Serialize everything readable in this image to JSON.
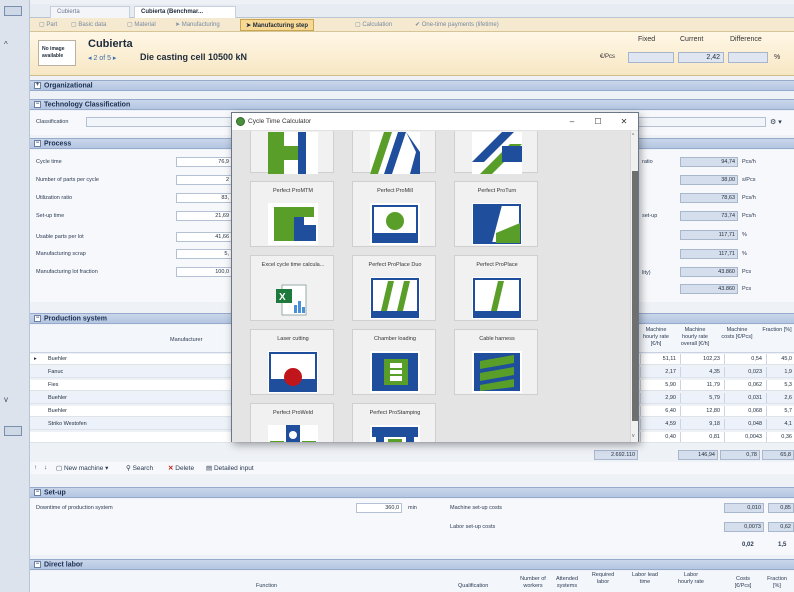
{
  "window_tabs": [
    {
      "label": "Cubierta",
      "active": false
    },
    {
      "label": "Cubierta (Benchmar...",
      "active": true
    }
  ],
  "sub_tabs": [
    {
      "label": "Part",
      "active": false
    },
    {
      "label": "Basic data",
      "active": false
    },
    {
      "label": "Material",
      "active": false
    },
    {
      "label": "Manufacturing",
      "active": false
    },
    {
      "label": "Manufacturing step",
      "active": true
    },
    {
      "label": "Calculation",
      "active": false
    },
    {
      "label": "One-time payments (lifetime)",
      "active": false
    }
  ],
  "header": {
    "no_image": "No image available",
    "title": "Cubierta",
    "nav": "◂ 2 of 5 ▸",
    "subtitle": "Die casting cell 10500 kN",
    "unit": "€/Pcs",
    "col_fixed": "Fixed",
    "col_current": "Current",
    "col_difference": "Difference",
    "current_value": "2,42",
    "percent": "%"
  },
  "sections": {
    "organizational": "Organizational",
    "tech_classification": "Technology Classification",
    "process": "Process",
    "production_system": "Production system",
    "setup": "Set-up",
    "direct_labor": "Direct labor"
  },
  "tech": {
    "classification_label": "Classification"
  },
  "process": {
    "labels": [
      "Cycle time",
      "Number of parts per cycle",
      "Utilization ratio",
      "Set-up time",
      "Usable parts per lot",
      "Manufacturing scrap",
      "Manufacturing lot fraction"
    ],
    "values": [
      "76,9",
      "2",
      "83,",
      "21,69",
      "41,66",
      "5,",
      "100,0"
    ],
    "right_labels": [
      "ratio",
      "",
      "",
      "set-up",
      "",
      "",
      "lity)",
      ""
    ],
    "right_values": [
      "94,74",
      "38,00",
      "78,63",
      "73,74",
      "117,71",
      "117,71",
      "43.860",
      "43.860"
    ],
    "right_units": [
      "Pcs/h",
      "s/Pcs",
      "Pcs/h",
      "Pcs/h",
      "%",
      "%",
      "Pcs",
      "Pcs"
    ]
  },
  "production": {
    "col_manufacturer": "Manufacturer",
    "headers": [
      "Machine hourly rate [€/h]",
      "Machine hourly rate overall [€/h]",
      "Machine costs [€/Pcs]",
      "Fraction [%]"
    ],
    "rows": [
      {
        "name": "Buehler",
        "v": [
          "51,11",
          "102,23",
          "0,54",
          "45,0"
        ]
      },
      {
        "name": "Fanuc",
        "v": [
          "2,17",
          "4,35",
          "0,023",
          "1,9"
        ]
      },
      {
        "name": "Fies",
        "v": [
          "5,90",
          "11,79",
          "0,062",
          "5,3"
        ]
      },
      {
        "name": "Buehler",
        "v": [
          "2,90",
          "5,79",
          "0,031",
          "2,6"
        ]
      },
      {
        "name": "Buehler",
        "v": [
          "6,40",
          "12,80",
          "0,068",
          "5,7"
        ]
      },
      {
        "name": "Striko Westofen",
        "v": [
          "4,59",
          "9,18",
          "0,048",
          "4,1"
        ]
      },
      {
        "name": "",
        "v": [
          "0,40",
          "0,81",
          "0,0043",
          "0,36"
        ]
      }
    ],
    "total_left": "2.692.110",
    "totals": [
      "146,94",
      "0,78",
      "65,8"
    ]
  },
  "toolbar": {
    "new_machine": "New machine",
    "search": "Search",
    "delete": "Delete",
    "detailed_input": "Detailed input"
  },
  "setup": {
    "downtime_label": "Downtime of production system",
    "downtime_value": "360,0",
    "downtime_unit": "min",
    "machine_costs_label": "Machine set-up costs",
    "machine_costs": [
      "0,010",
      "0,85"
    ],
    "labor_costs_label": "Labor set-up costs",
    "labor_costs": [
      "0,0073",
      "0,62"
    ],
    "total": [
      "0,02",
      "1,5"
    ]
  },
  "direct_labor": {
    "col_function": "Function",
    "col_qualification": "Qualification",
    "cols": [
      "Number of workers",
      "Attended systems",
      "Required labor",
      "Labor lead time",
      "Labor hourly rate",
      "Costs [€/Pcs]",
      "Fraction [%]"
    ]
  },
  "dialog": {
    "title": "Cycle Time Calculator",
    "minimize": "–",
    "maximize": "☐",
    "close": "✕",
    "tiles": [
      {
        "label": "",
        "icon": "partial-top-1"
      },
      {
        "label": "",
        "icon": "partial-top-2"
      },
      {
        "label": "",
        "icon": "partial-top-3"
      },
      {
        "label": "Perfect ProMTM",
        "icon": "promtm-icon"
      },
      {
        "label": "Perfect ProMill",
        "icon": "promill-icon"
      },
      {
        "label": "Perfect ProTurn",
        "icon": "proturn-icon"
      },
      {
        "label": "Excel cycle time calcula...",
        "icon": "excel-icon"
      },
      {
        "label": "Perfect ProPlace Duo",
        "icon": "proplace-duo-icon"
      },
      {
        "label": "Perfect ProPlace",
        "icon": "proplace-icon"
      },
      {
        "label": "Laser cutting",
        "icon": "laser-cutting-icon"
      },
      {
        "label": "Chamber loading",
        "icon": "chamber-loading-icon"
      },
      {
        "label": "Cable harness",
        "icon": "cable-harness-icon"
      },
      {
        "label": "Perfect ProWeld",
        "icon": "proweld-icon"
      },
      {
        "label": "Perfect ProStamping",
        "icon": "prostamping-icon"
      }
    ]
  },
  "colors": {
    "accent_blue": "#1f4e9c",
    "accent_green": "#5a9e2a",
    "laser_red": "#c0161b"
  }
}
